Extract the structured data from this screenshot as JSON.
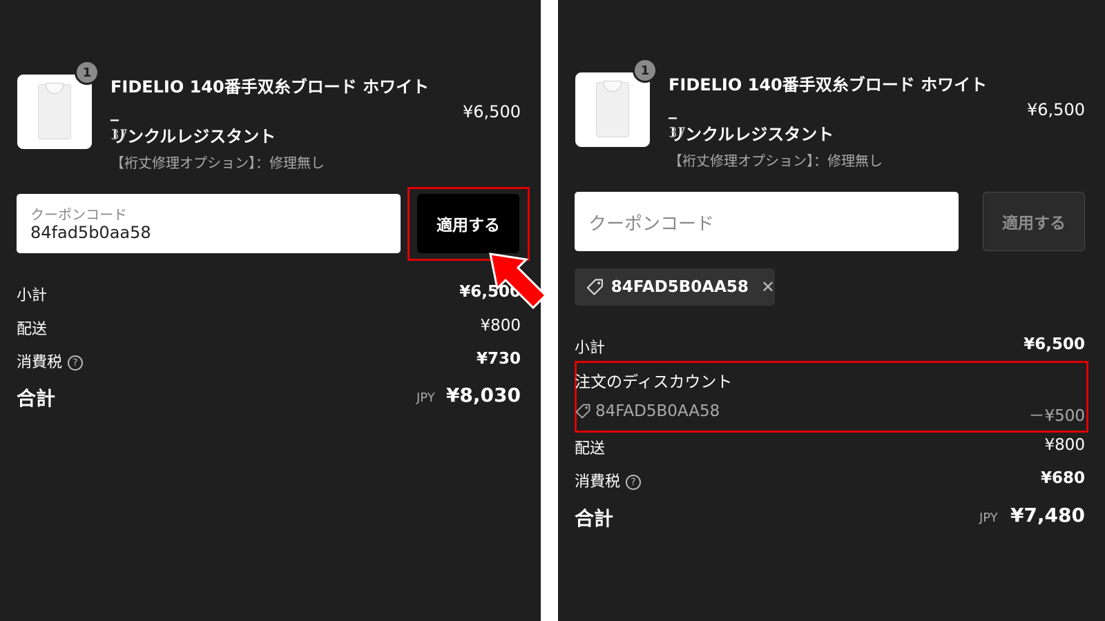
{
  "left": {
    "item": {
      "quantity": "1",
      "name_line1": "FIDELIO 140番手双糸ブロード ホワイト_",
      "name_line2": "リンクルレジスタント",
      "variant": "37",
      "option": "【裄丈修理オプション】：修理無し",
      "price": "¥6,500"
    },
    "coupon": {
      "placeholder": "クーポンコード",
      "value": "84fad5b0aa58",
      "apply_label": "適用する"
    },
    "summary": {
      "subtotal_label": "小計",
      "subtotal_value": "¥6,500",
      "shipping_label": "配送",
      "shipping_value": "¥800",
      "tax_label": "消費税",
      "tax_value": "¥730",
      "total_label": "合計",
      "currency": "JPY",
      "total_value": "¥8,030"
    }
  },
  "right": {
    "item": {
      "quantity": "1",
      "name_line1": "FIDELIO 140番手双糸ブロード ホワイト_",
      "name_line2": "リンクルレジスタント",
      "variant": "37",
      "option": "【裄丈修理オプション】：修理無し",
      "price": "¥6,500"
    },
    "coupon": {
      "placeholder": "クーポンコード",
      "apply_label": "適用する"
    },
    "applied_code": {
      "code": "84FAD5B0AA58",
      "remove_icon": "close-icon"
    },
    "summary": {
      "subtotal_label": "小計",
      "subtotal_value": "¥6,500",
      "discount_title": "注文のディスカウント",
      "discount_code": "84FAD5B0AA58",
      "discount_value": "－¥500",
      "shipping_label": "配送",
      "shipping_value": "¥800",
      "tax_label": "消費税",
      "tax_value": "¥680",
      "total_label": "合計",
      "currency": "JPY",
      "total_value": "¥7,480"
    }
  },
  "colors": {
    "panel_bg": "#1f1f1f",
    "highlight_red": "#e00000",
    "arrow_red": "#ff0000"
  }
}
